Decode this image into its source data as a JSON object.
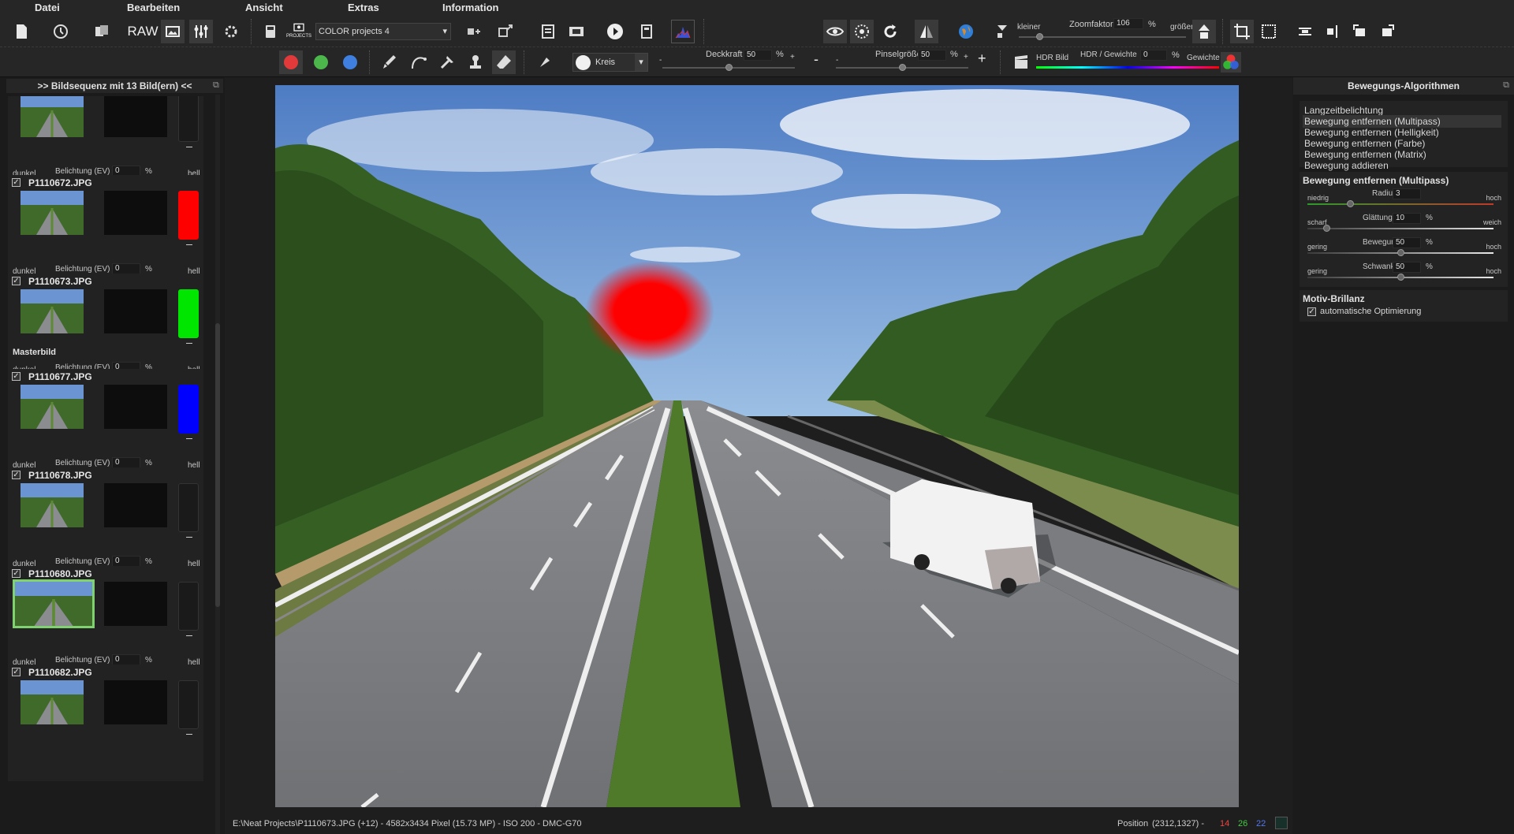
{
  "menu": [
    "Datei",
    "Bearbeiten",
    "Ansicht",
    "Extras",
    "Information"
  ],
  "toolbar1": {
    "raw_label": "RAW",
    "projects_label": "PROJECTS",
    "project_select": "COLOR projects 4",
    "zoom_small": "kleiner",
    "zoom_label": "Zoomfaktor",
    "zoom_value": "106",
    "zoom_unit": "%",
    "zoom_big": "größer"
  },
  "toolbar2": {
    "brush_shape": "Kreis",
    "opacity_label": "Deckkraft",
    "opacity_value": "50",
    "opacity_unit": "%",
    "minus": "-",
    "plus": "+",
    "brush_size_label": "Pinselgröße",
    "brush_size_value": "50",
    "brush_size_unit": "%",
    "hdr_label": "HDR Bild",
    "hdr_weight_label": "HDR / Gewichte",
    "hdr_weight_value": "0",
    "hdr_weight_unit": "%",
    "weights_label": "Gewichte",
    "opacity_level": 0.5,
    "brush_size_level": 0.5
  },
  "left_panel": {
    "title": ">> Bildsequenz mit 13 Bild(ern) <<",
    "dark_label": "dunkel",
    "ev_label": "Belichtung (EV)",
    "ev_unit": "%",
    "light_label": "hell",
    "master_label": "Masterbild",
    "frames": [
      {
        "name": "",
        "ev": "0",
        "swatch": "",
        "master": false,
        "selected": false
      },
      {
        "name": "P1110672.JPG",
        "ev": "0",
        "swatch": "#ff0000",
        "master": false,
        "selected": false
      },
      {
        "name": "P1110673.JPG",
        "ev": "0",
        "swatch": "#00e600",
        "master": true,
        "selected": false
      },
      {
        "name": "P1110677.JPG",
        "ev": "0",
        "swatch": "#0000ff",
        "master": false,
        "selected": false
      },
      {
        "name": "P1110678.JPG",
        "ev": "0",
        "swatch": "",
        "master": false,
        "selected": false
      },
      {
        "name": "P1110680.JPG",
        "ev": "0",
        "swatch": "",
        "master": false,
        "selected": true
      },
      {
        "name": "P1110682.JPG",
        "ev": "",
        "swatch": "",
        "master": false,
        "selected": false
      }
    ]
  },
  "right_panel": {
    "title": "Bewegungs-Algorithmen",
    "algorithms": [
      "Langzeitbelichtung",
      "Bewegung entfernen (Multipass)",
      "Bewegung entfernen (Helligkeit)",
      "Bewegung entfernen (Farbe)",
      "Bewegung entfernen (Matrix)",
      "Bewegung addieren"
    ],
    "selected_algorithm": 1,
    "params_title": "Bewegung entfernen (Multipass)",
    "params": [
      {
        "left": "niedrig",
        "name": "Radius",
        "value": "3",
        "unit": "",
        "right": "hoch",
        "level": 0.23
      },
      {
        "left": "scharf",
        "name": "Glättung",
        "value": "10",
        "unit": "%",
        "right": "weich",
        "level": 0.1
      },
      {
        "left": "gering",
        "name": "Bewegung",
        "value": "50",
        "unit": "%",
        "right": "hoch",
        "level": 0.5
      },
      {
        "left": "gering",
        "name": "Schwankung",
        "value": "50",
        "unit": "%",
        "right": "hoch",
        "level": 0.5
      }
    ],
    "brilliance_title": "Motiv-Brillanz",
    "auto_opt_label": "automatische Optimierung",
    "auto_opt_checked": true
  },
  "status": {
    "file_info": "E:\\Neat Projects\\P1110673.JPG (+12) - 4582x3434 Pixel (15.73 MP)   - ISO 200 - DMC-G70",
    "position_label": "Position",
    "position_value": "(2312,1327) -",
    "r": "14",
    "g": "26",
    "b": "22"
  },
  "colors": {
    "accent_green": "#7fd26f",
    "red": "#ff0000",
    "green": "#00e600",
    "blue": "#0000ff"
  }
}
